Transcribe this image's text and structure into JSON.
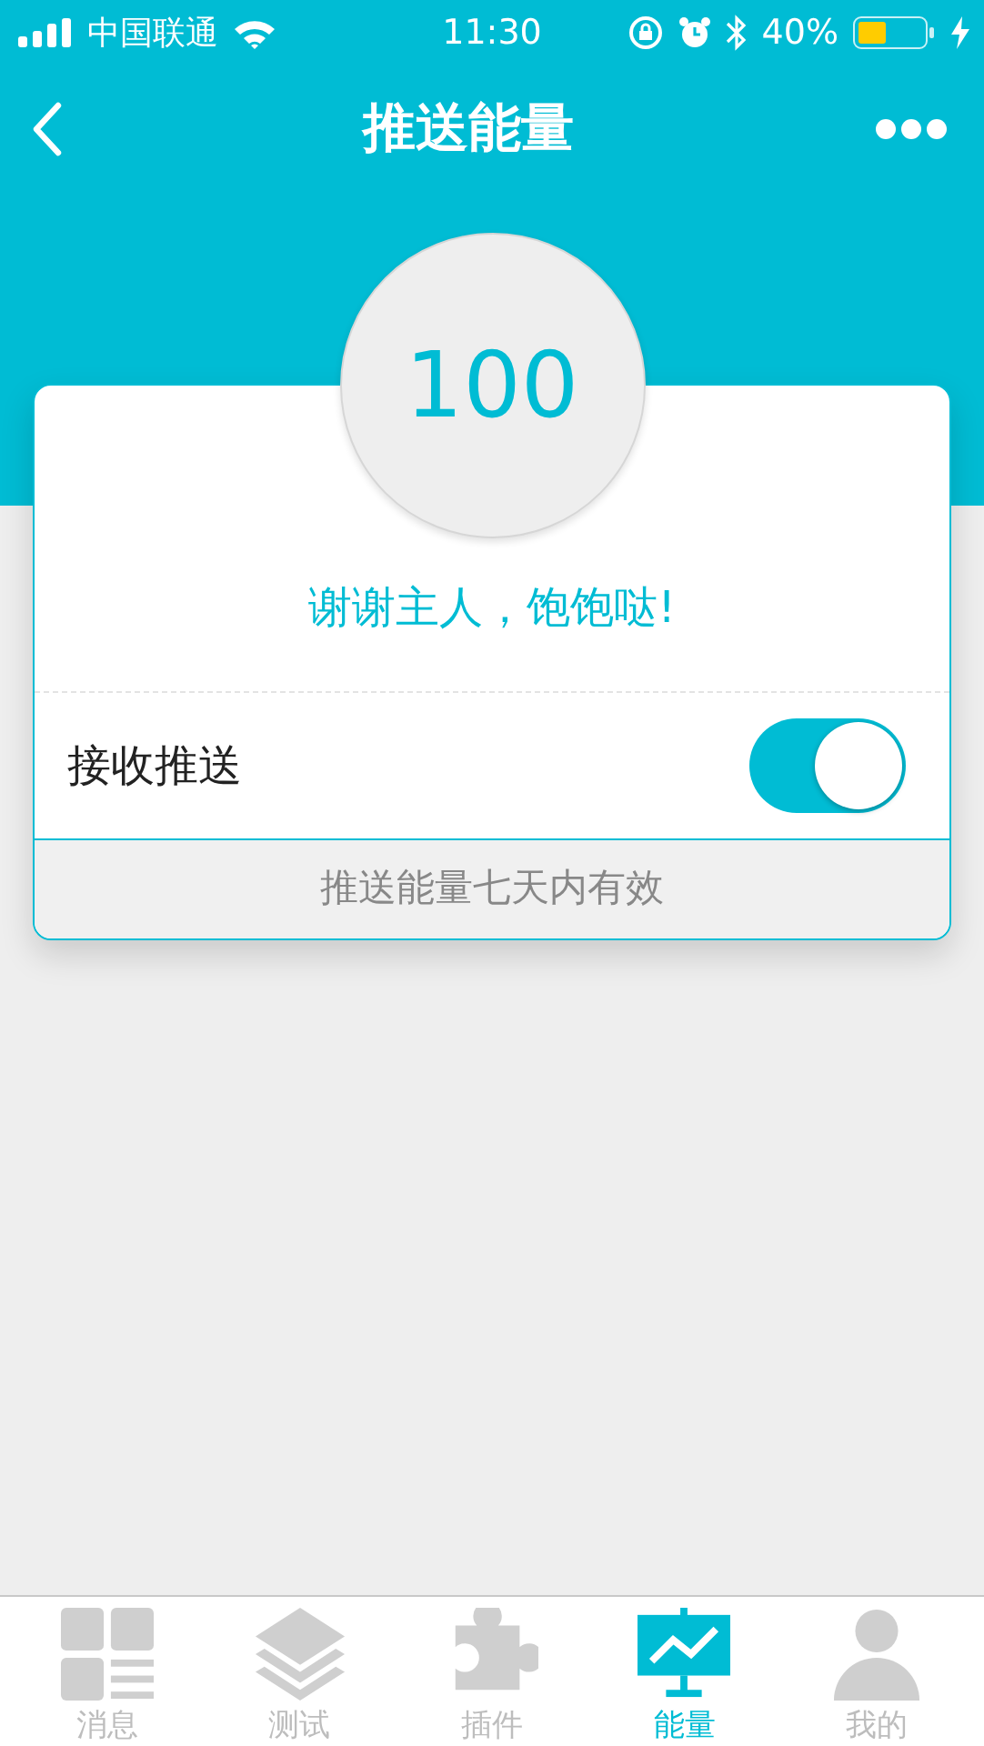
{
  "status_bar": {
    "carrier": "中国联通",
    "time": "11:30",
    "battery": "40%"
  },
  "nav": {
    "title": "推送能量"
  },
  "energy": {
    "value": "100",
    "message": "谢谢主人，饱饱哒!"
  },
  "push": {
    "label": "接收推送",
    "on": true
  },
  "note": "推送能量七天内有效",
  "tabs": [
    {
      "label": "消息",
      "selected": false
    },
    {
      "label": "测试",
      "selected": false
    },
    {
      "label": "插件",
      "selected": false
    },
    {
      "label": "能量",
      "selected": true
    },
    {
      "label": "我的",
      "selected": false
    }
  ]
}
